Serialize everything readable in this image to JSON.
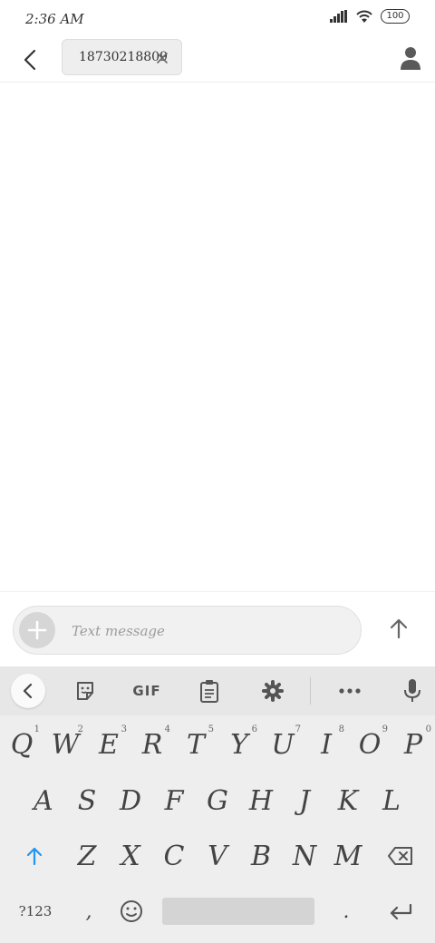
{
  "status_bar": {
    "time": "2:36 AM",
    "battery": "100"
  },
  "header": {
    "recipient": "18730218809"
  },
  "compose": {
    "placeholder": "Text message"
  },
  "keyboard": {
    "toolbar": {
      "gif_label": "GIF"
    },
    "row1": [
      {
        "letter": "Q",
        "hint": "1"
      },
      {
        "letter": "W",
        "hint": "2"
      },
      {
        "letter": "E",
        "hint": "3"
      },
      {
        "letter": "R",
        "hint": "4"
      },
      {
        "letter": "T",
        "hint": "5"
      },
      {
        "letter": "Y",
        "hint": "6"
      },
      {
        "letter": "U",
        "hint": "7"
      },
      {
        "letter": "I",
        "hint": "8"
      },
      {
        "letter": "O",
        "hint": "9"
      },
      {
        "letter": "P",
        "hint": "0"
      }
    ],
    "row2": [
      "A",
      "S",
      "D",
      "F",
      "G",
      "H",
      "J",
      "K",
      "L"
    ],
    "row3": [
      "Z",
      "X",
      "C",
      "V",
      "B",
      "N",
      "M"
    ],
    "symbols_label": "?123",
    "comma": ",",
    "period": "."
  },
  "icons": {
    "back": "arrow-left-icon",
    "clear": "close-icon",
    "contact": "person-icon",
    "attach": "plus-icon",
    "send": "arrow-up-icon",
    "collapse": "chevron-left-icon",
    "sticker": "sticker-icon",
    "clipboard": "clipboard-icon",
    "settings": "gear-icon",
    "more": "more-horizontal-icon",
    "mic": "microphone-icon",
    "shift": "shift-arrow-icon",
    "backspace": "backspace-icon",
    "emoji": "smiley-icon",
    "enter": "enter-icon"
  },
  "colors": {
    "accent": "#2196f3",
    "text": "#333333",
    "keyboard_bg": "#eeeeee"
  }
}
